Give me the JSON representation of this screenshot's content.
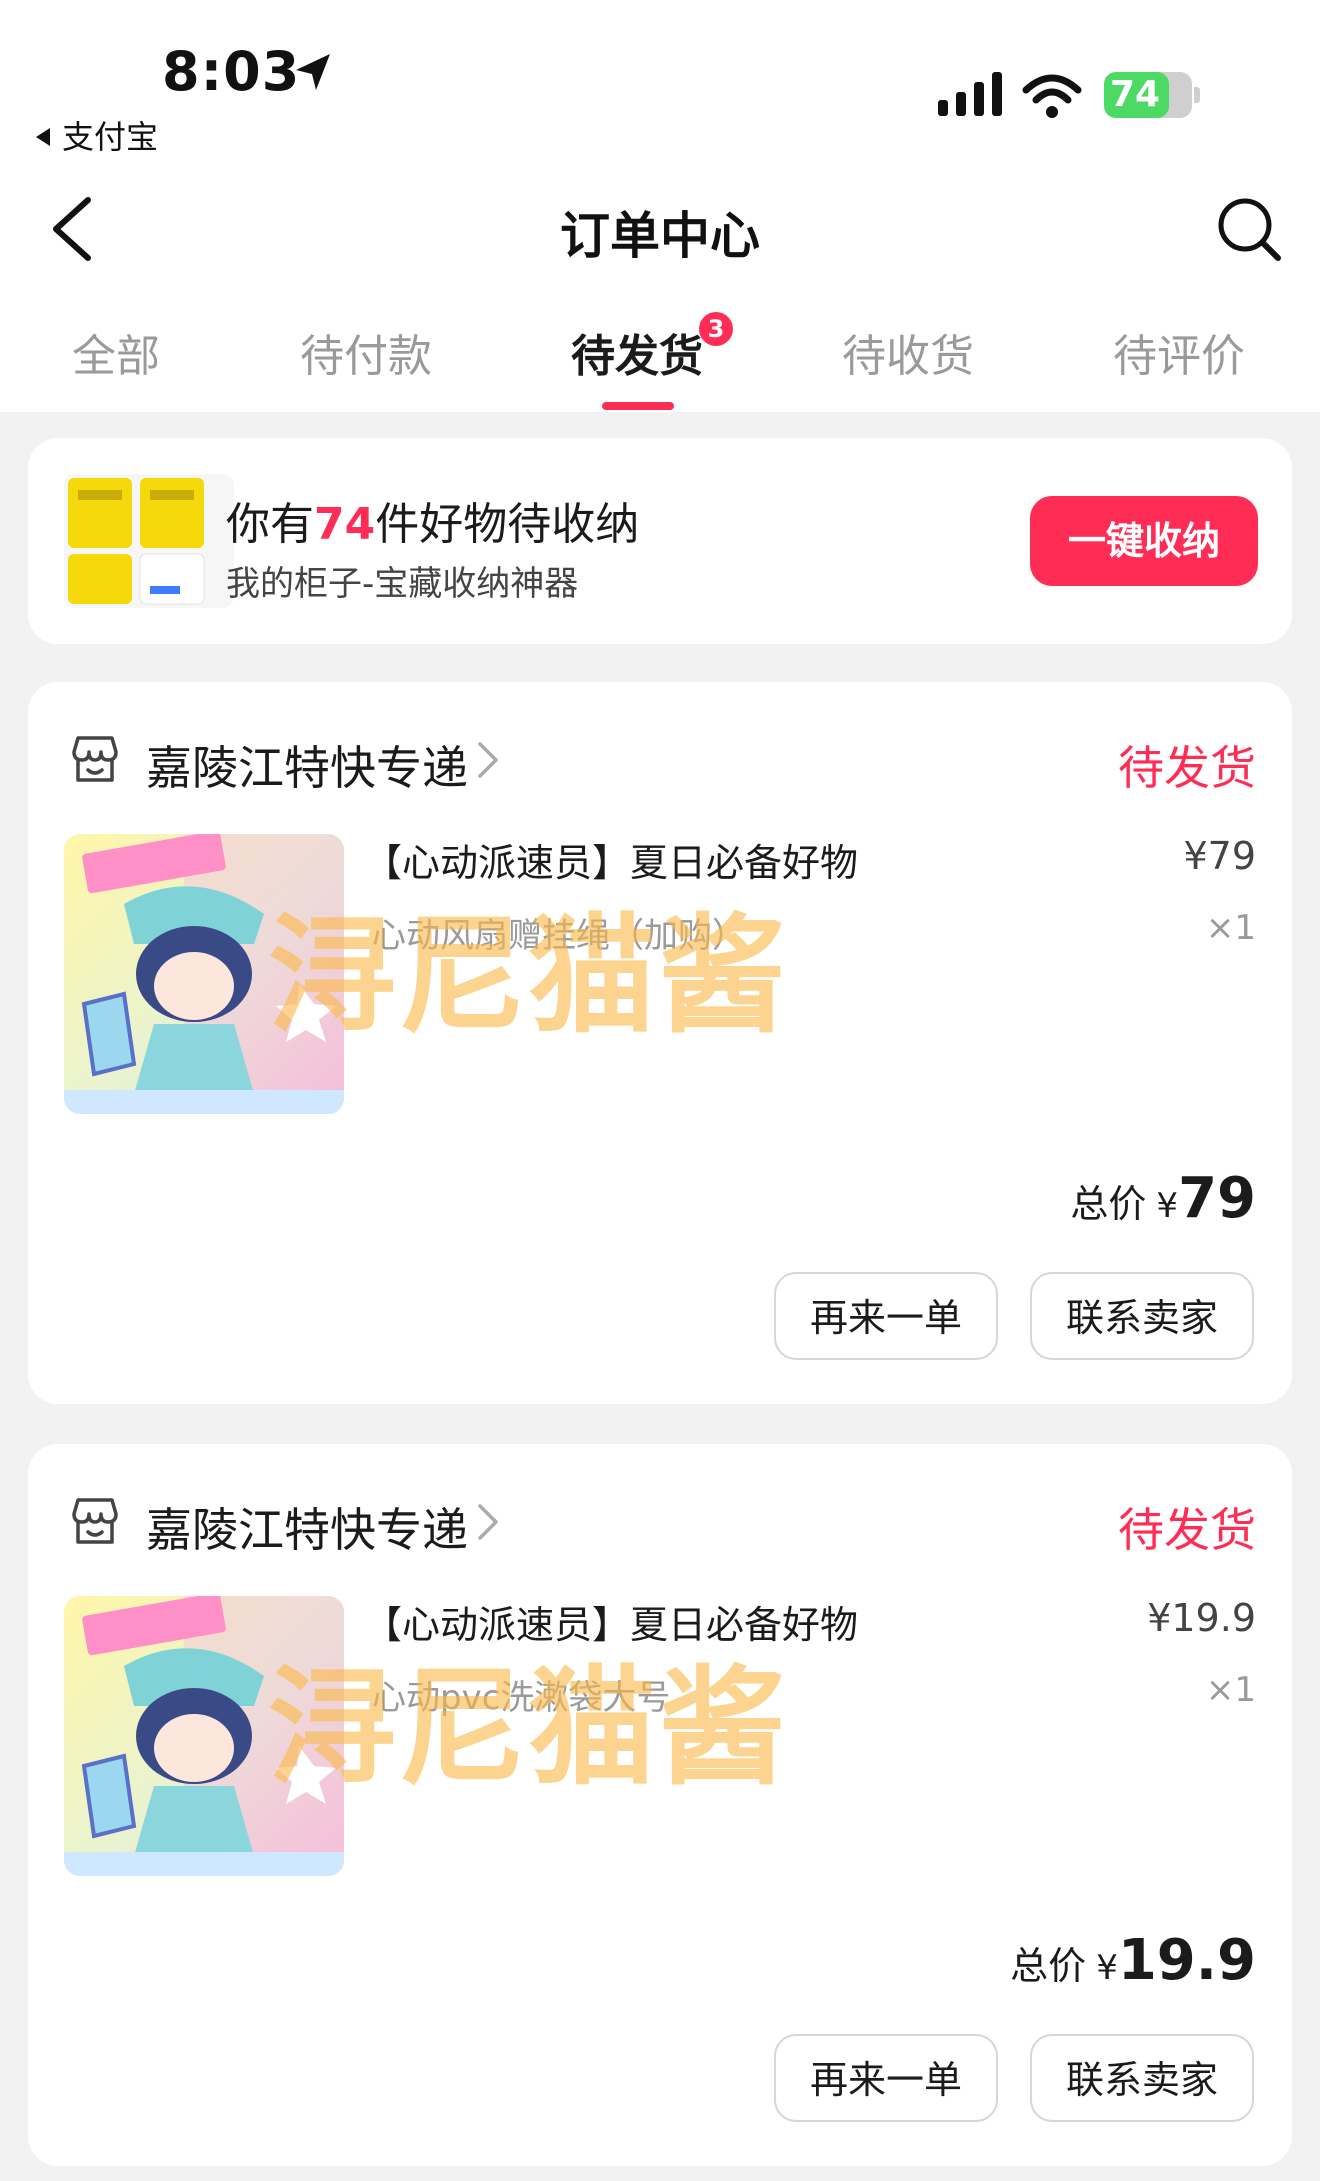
{
  "status_bar": {
    "time": "8:03",
    "back_app": "支付宝",
    "battery": "74",
    "battery_level": 0.74
  },
  "nav": {
    "title": "订单中心"
  },
  "tabs": [
    {
      "label": "全部"
    },
    {
      "label": "待付款"
    },
    {
      "label": "待发货",
      "active": true,
      "badge": "3"
    },
    {
      "label": "待收货"
    },
    {
      "label": "待评价"
    }
  ],
  "promo": {
    "title_prefix": "你有",
    "count": "74",
    "title_suffix": "件好物待收纳",
    "subtitle": "我的柜子-宝藏收纳神器",
    "button": "一键收纳"
  },
  "orders": [
    {
      "store": "嘉陵江特快专递",
      "status": "待发货",
      "title": "【心动派速员】夏日必备好物",
      "spec": "心动风扇赠挂绳（加购）",
      "price": "¥79",
      "qty": "×1",
      "total_label": "总价",
      "total_currency": "¥",
      "total_amount": "79",
      "btn_again": "再来一单",
      "btn_contact": "联系卖家"
    },
    {
      "store": "嘉陵江特快专递",
      "status": "待发货",
      "title": "【心动派速员】夏日必备好物",
      "spec": "心动pvc洗漱袋大号",
      "price": "¥19.9",
      "qty": "×1",
      "total_label": "总价",
      "total_currency": "¥",
      "total_amount": "19.9",
      "btn_again": "再来一单",
      "btn_contact": "联系卖家"
    }
  ],
  "watermark": "浔尼猫酱",
  "colors": {
    "accent": "#ff2d55",
    "watermark": "#fab94b",
    "battery_green": "#4cd964"
  }
}
